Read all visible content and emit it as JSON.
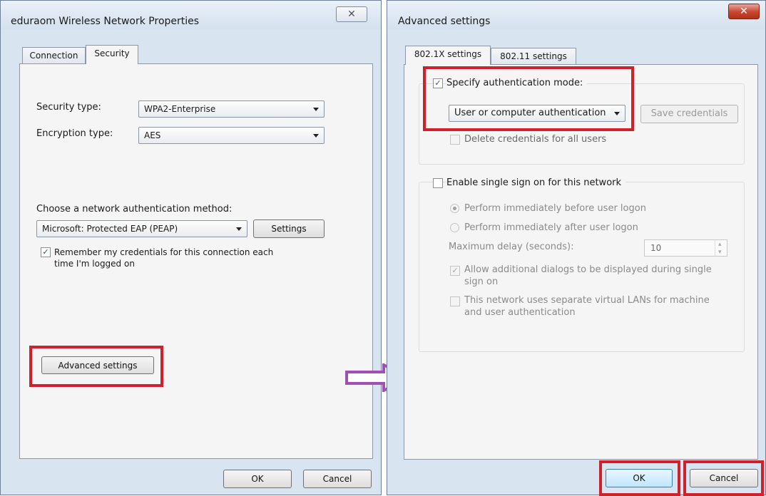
{
  "left_window": {
    "title": "eduraom Wireless Network Properties",
    "tabs": [
      {
        "label": "Connection"
      },
      {
        "label": "Security"
      }
    ],
    "security_type_label": "Security type:",
    "security_type_value": "WPA2-Enterprise",
    "encryption_type_label": "Encryption type:",
    "encryption_type_value": "AES",
    "auth_method_label": "Choose a network authentication method:",
    "auth_method_value": "Microsoft: Protected EAP (PEAP)",
    "settings_button": "Settings",
    "remember_line1": "Remember my credentials for this connection each",
    "remember_line2": "time I'm logged on",
    "advanced_button": "Advanced settings",
    "ok_button": "OK",
    "cancel_button": "Cancel",
    "close_glyph": "✕"
  },
  "right_window": {
    "title": "Advanced settings",
    "tabs": [
      {
        "label": "802.1X settings"
      },
      {
        "label": "802.11 settings"
      }
    ],
    "specify_auth_label": "Specify authentication mode:",
    "auth_mode_value": "User or computer authentication",
    "save_credentials_button": "Save credentials",
    "delete_credentials_label": "Delete credentials for all users",
    "sso_label": "Enable single sign on for this network",
    "perform_before_label": "Perform immediately before user logon",
    "perform_after_label": "Perform immediately after user logon",
    "max_delay_label": "Maximum delay (seconds):",
    "max_delay_value": "10",
    "allow_dialogs_line1": "Allow additional dialogs to be displayed during single",
    "allow_dialogs_line2": "sign on",
    "separate_vlans_line1": "This network uses separate virtual LANs for machine",
    "separate_vlans_line2": "and user authentication",
    "ok_button": "OK",
    "cancel_button": "Cancel",
    "close_glyph": "✕"
  },
  "colors": {
    "highlight": "#d0202b",
    "arrow": "#a050b0"
  }
}
